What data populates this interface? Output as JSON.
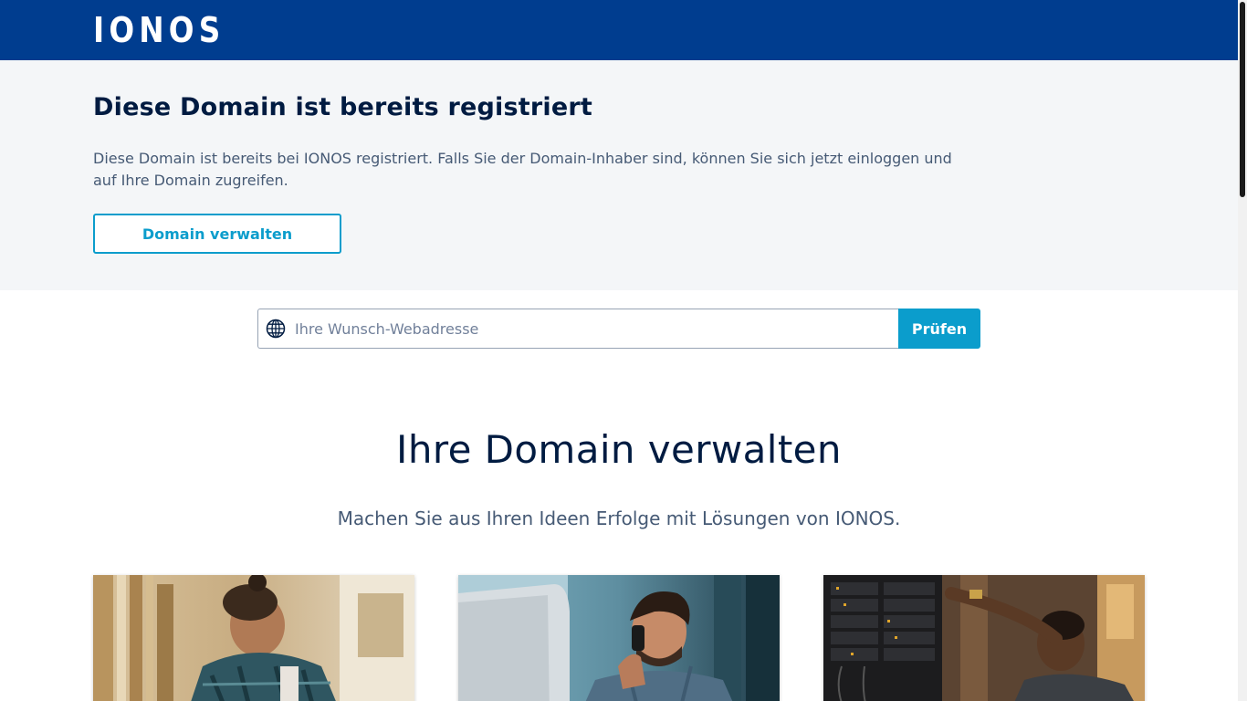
{
  "header": {
    "logo_text": "IONOS",
    "background": "#003d8f"
  },
  "notice": {
    "title": "Diese Domain ist bereits registriert",
    "text": "Diese Domain ist bereits bei IONOS registriert. Falls Sie der Domain-Inhaber sind, können Sie sich jetzt einloggen und auf Ihre Domain zugreifen.",
    "button_label": "Domain verwalten"
  },
  "search": {
    "icon": "globe-icon",
    "placeholder": "Ihre Wunsch-Webadresse",
    "button_label": "Prüfen"
  },
  "manage": {
    "title": "Ihre Domain verwalten",
    "subtitle": "Machen Sie aus Ihren Ideen Erfolge mit Lösungen von IONOS."
  },
  "cards": [
    {
      "image": "craftsman-workshop-photo"
    },
    {
      "image": "man-on-phone-at-computer-photo"
    },
    {
      "image": "technician-server-rack-photo"
    }
  ],
  "colors": {
    "accent": "#0b9dcc",
    "heading": "#001b41",
    "body_text": "#465a75",
    "notice_bg": "#f4f6f8"
  }
}
